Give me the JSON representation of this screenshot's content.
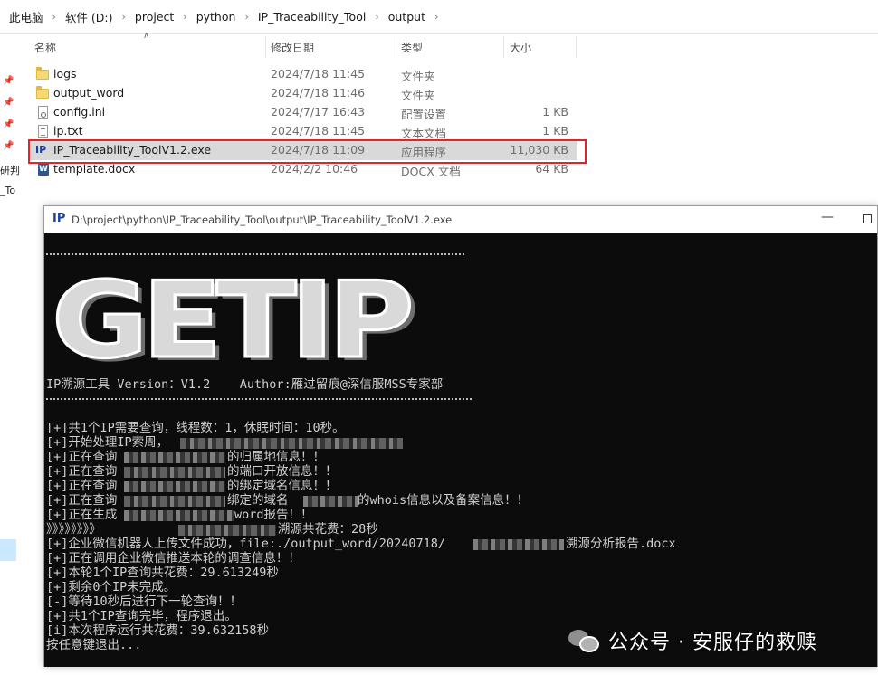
{
  "breadcrumb": [
    "此电脑",
    "软件 (D:)",
    "project",
    "python",
    "IP_Traceability_Tool",
    "output"
  ],
  "left_nav": {
    "text1": "研判",
    "text2": "_To"
  },
  "columns": {
    "name": "名称",
    "date": "修改日期",
    "type": "类型",
    "size": "大小"
  },
  "files": [
    {
      "name": "logs",
      "date": "2024/7/18 11:45",
      "type": "文件夹",
      "size": "",
      "icon": "folder-icon"
    },
    {
      "name": "output_word",
      "date": "2024/7/18 11:46",
      "type": "文件夹",
      "size": "",
      "icon": "folder-icon"
    },
    {
      "name": "config.ini",
      "date": "2024/7/17 16:43",
      "type": "配置设置",
      "size": "1 KB",
      "icon": "config-file-icon"
    },
    {
      "name": "ip.txt",
      "date": "2024/7/18 11:45",
      "type": "文本文档",
      "size": "1 KB",
      "icon": "text-file-icon"
    },
    {
      "name": "IP_Traceability_ToolV1.2.exe",
      "date": "2024/7/18 11:09",
      "type": "应用程序",
      "size": "11,030 KB",
      "icon": "exe-icon"
    },
    {
      "name": "template.docx",
      "date": "2024/2/2 10:46",
      "type": "DOCX 文档",
      "size": "64 KB",
      "icon": "word-doc-icon"
    }
  ],
  "console": {
    "app_icon": "IP",
    "title": "D:\\project\\python\\IP_Traceability_Tool\\output\\IP_Traceability_ToolV1.2.exe",
    "minimize": "—",
    "banner": "GETIP",
    "version_line": "IP溯源工具 Version：V1.2    Author:雁过留痕@深信服MSS专家部",
    "lines": [
      "[+]共1个IP需要查询，线程数：1，休眠时间：10秒。",
      "[+]开始处理IP索周，",
      "[+]正在查询",
      "[+]正在查询",
      "[+]正在查询",
      "[+]正在查询",
      "[+]正在生成",
      "》》》》》》》》",
      "[+]企业微信机器人上传文件成功，file:./output_word/20240718/",
      "[+]正在调用企业微信推送本轮的调查信息！！",
      "[+]本轮1个IP查询共花费：29.613249秒",
      "[+]剩余0个IP未完成。",
      "[-]等待10秒后进行下一轮查询！！",
      "[+]共1个IP查询完毕，程序退出。",
      "[i]本次程序运行共花费：39.632158秒",
      "按任意键退出..."
    ],
    "frag": {
      "l2": "的归属地信息！！",
      "l3": "的端口开放信息！！",
      "l4": "的绑定域名信息！！",
      "l5a": "绑定的域名",
      "l5b": "的whois信息以及备案信息！！",
      "l6": "word报告！！",
      "l7": "溯源共花费：28秒",
      "l8": "溯源分析报告.docx"
    }
  },
  "watermark": "公众号 · 安服仔的救赎"
}
